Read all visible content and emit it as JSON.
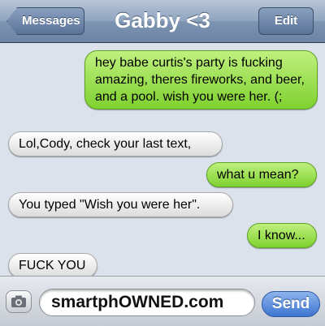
{
  "navbar": {
    "back_label": "Messages",
    "title": "Gabby <3",
    "edit_label": "Edit"
  },
  "messages": [
    {
      "side": "out",
      "text": "hey babe curtis's party is fucking amazing, theres fireworks, and beer, and a pool. wish you were her. (;"
    },
    {
      "side": "in",
      "text": "Lol,Cody, check your last text,"
    },
    {
      "side": "out",
      "text": "what u mean?"
    },
    {
      "side": "in",
      "text": "You typed \"Wish you were her\"."
    },
    {
      "side": "out",
      "text": "I know..."
    },
    {
      "side": "in",
      "text": "FUCK YOU"
    }
  ],
  "composer": {
    "input_value": "smartphOWNED.com",
    "send_label": "Send",
    "camera_icon": "camera-icon"
  },
  "colors": {
    "outgoing_bubble": "#8fd83c",
    "incoming_bubble": "#e9e9e9",
    "send_button": "#4a7fd4",
    "background": "#dbe2ec"
  }
}
